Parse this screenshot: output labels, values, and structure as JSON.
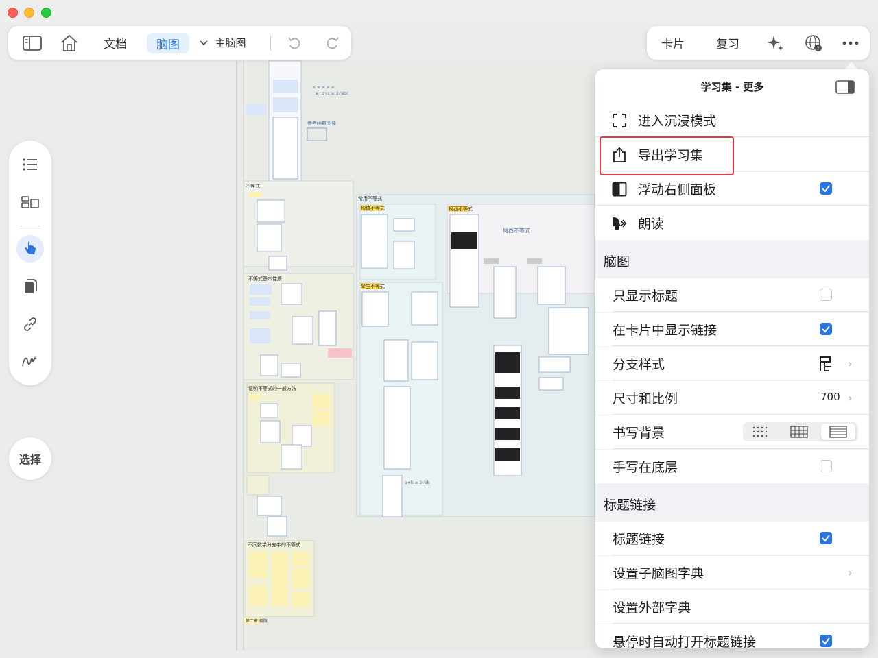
{
  "toolbar_left": {
    "items": [
      "文档",
      "脑图",
      "主脑图"
    ],
    "active": "脑图"
  },
  "toolbar_right": {
    "items": [
      "卡片",
      "复习"
    ]
  },
  "side": {
    "select_label": "选择"
  },
  "mindmap": {
    "sections": [
      "不等式",
      "常用不等式",
      "不等式基本性质",
      "证明不等式的一般方法",
      "不同数学分支中的不等式",
      "第二章 极限"
    ],
    "highlight_labels": [
      "均值不等式",
      "柯西不等式",
      "琴生不等式"
    ]
  },
  "menu": {
    "title": "学习集 - 更多",
    "rows": [
      {
        "label": "进入沉浸模式"
      },
      {
        "label": "导出学习集"
      },
      {
        "label": "浮动右侧面板",
        "checked": true
      },
      {
        "label": "朗读"
      }
    ],
    "section_mindmap": "脑图",
    "mindmap_rows": [
      {
        "label": "只显示标题",
        "checked": false
      },
      {
        "label": "在卡片中显示链接",
        "checked": true
      },
      {
        "label": "分支样式"
      },
      {
        "label": "尺寸和比例",
        "value": "700"
      },
      {
        "label": "书写背景"
      },
      {
        "label": "手写在底层",
        "checked": false
      }
    ],
    "section_links": "标题链接",
    "link_rows": [
      {
        "label": "标题链接",
        "checked": true
      },
      {
        "label": "设置子脑图字典"
      },
      {
        "label": "设置外部字典"
      },
      {
        "label": "悬停时自动打开标题链接",
        "checked": true
      }
    ]
  },
  "colors": {
    "accent": "#2a74e4",
    "highlight_border": "#e0393e"
  }
}
